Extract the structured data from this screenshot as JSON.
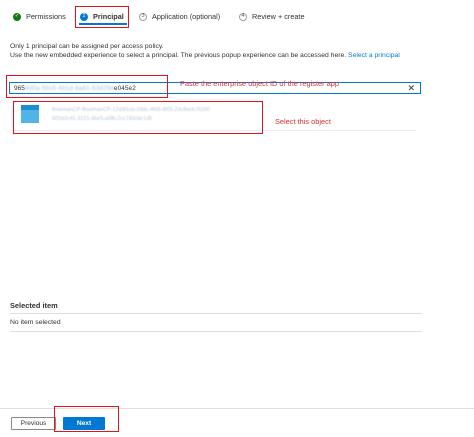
{
  "wizard": {
    "steps": [
      {
        "number": "1",
        "label": "Permissions",
        "state": "complete",
        "icon": "checkmark-icon"
      },
      {
        "number": "2",
        "label": "Principal",
        "state": "current"
      },
      {
        "number": "3",
        "label": "Application (optional)",
        "state": "pending"
      },
      {
        "number": "4",
        "label": "Review + create",
        "state": "pending"
      }
    ]
  },
  "description": {
    "line1": "Only 1 principal can be assigned per access policy.",
    "line2": "Use the new embedded experience to select a principal. The previous popup experience can be accessed here.",
    "link": "Select a principal"
  },
  "search": {
    "value_prefix": "965",
    "value_hidden": "8d0a-5bc6-4b1d-8a81-63d29d",
    "value_suffix": "e045e2",
    "clear_icon": "close-icon"
  },
  "results": [
    {
      "line1": "BowmanCP-BowmanCP-12d3f1cb-2ddc-4fd3-9f05-23c8acb76290",
      "line2": "602d2c41-3121-46e5-a0fb-2cc742cbc1d6"
    }
  ],
  "annotations": {
    "paste_hint": "Paste the enterprise object ID of the register app",
    "select_hint": "Select this object",
    "color": "#e1141c"
  },
  "selected": {
    "title": "Selected item",
    "empty": "No item selected"
  },
  "footer": {
    "previous_label": "Previous",
    "next_label": "Next"
  },
  "colors": {
    "accent": "#0078d4",
    "complete": "#107c10"
  }
}
